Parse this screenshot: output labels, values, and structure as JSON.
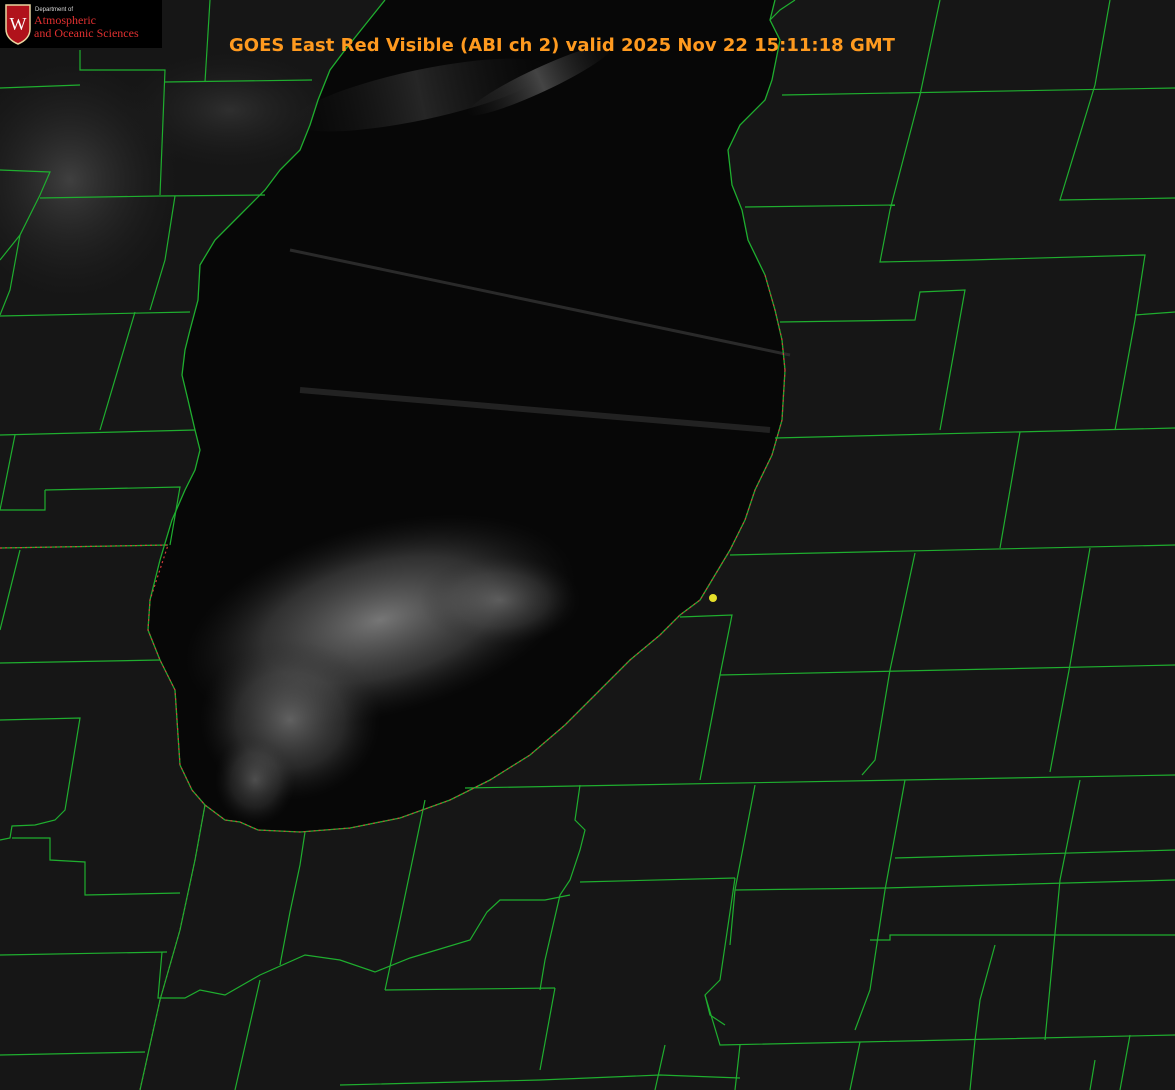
{
  "title": "GOES East Red Visible (ABI ch 2) valid 2025 Nov 22 15:11:18 GMT",
  "colors": {
    "title": "#ff9a1f",
    "county_lines": "#1fae2f",
    "state_line": "#d43c3c",
    "marker": "#e6e02a",
    "lake": "#060606",
    "land": "#161616",
    "logo_text": "#e03030"
  },
  "logo": {
    "shield_letter": "W",
    "small_text": "Department of",
    "line1": "Atmospheric",
    "line2": "and Oceanic Sciences"
  },
  "map": {
    "type": "satellite visible imagery",
    "lake": "lake-michigan-southern-basin",
    "overlays": [
      "county-boundaries",
      "state-boundaries",
      "station-marker"
    ]
  }
}
